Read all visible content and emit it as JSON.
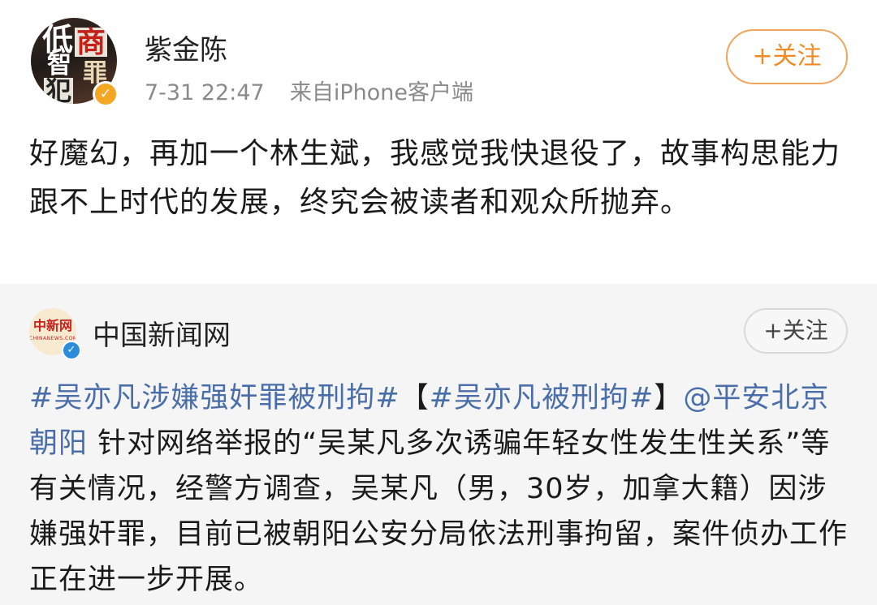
{
  "post": {
    "avatar_text": [
      "低",
      "商",
      "智",
      "罪",
      "犯"
    ],
    "verified_badge": "✓",
    "username": "紫金陈",
    "timestamp": "7-31 22:47",
    "source": "来自iPhone客户端",
    "follow_label": "+关注",
    "text": "好魔幻，再加一个林生斌，我感觉我快退役了，故事构思能力跟不上时代的发展，终究会被读者和观众所抛弃。"
  },
  "repost": {
    "avatar_logo": "中新网",
    "avatar_logo_sub": "CHINANEWS.COM",
    "verified_badge": "✓",
    "username": "中国新闻网",
    "follow_label": "+关注",
    "hashtag_1": "#吴亦凡涉嫌强奸罪被刑拘#",
    "bracket_open": "【",
    "hashtag_2": "#吴亦凡被刑拘#",
    "bracket_close": "】",
    "mention": "@平安北京朝阳",
    "body": " 针对网络举报的“吴某凡多次诱骗年轻女性发生性关系”等有关情况，经警方调查，吴某凡（男，30岁，加拿大籍）因涉嫌强奸罪，目前已被朝阳公安分局依法刑事拘留，案件侦办工作正在进一步开展。"
  },
  "colors": {
    "follow_orange": "#f08a24",
    "link_blue": "#4a6ea9",
    "meta_gray": "#8a8a8a",
    "repost_bg": "#f5f5f5"
  },
  "icons": {
    "verified": "verified-badge-icon"
  }
}
